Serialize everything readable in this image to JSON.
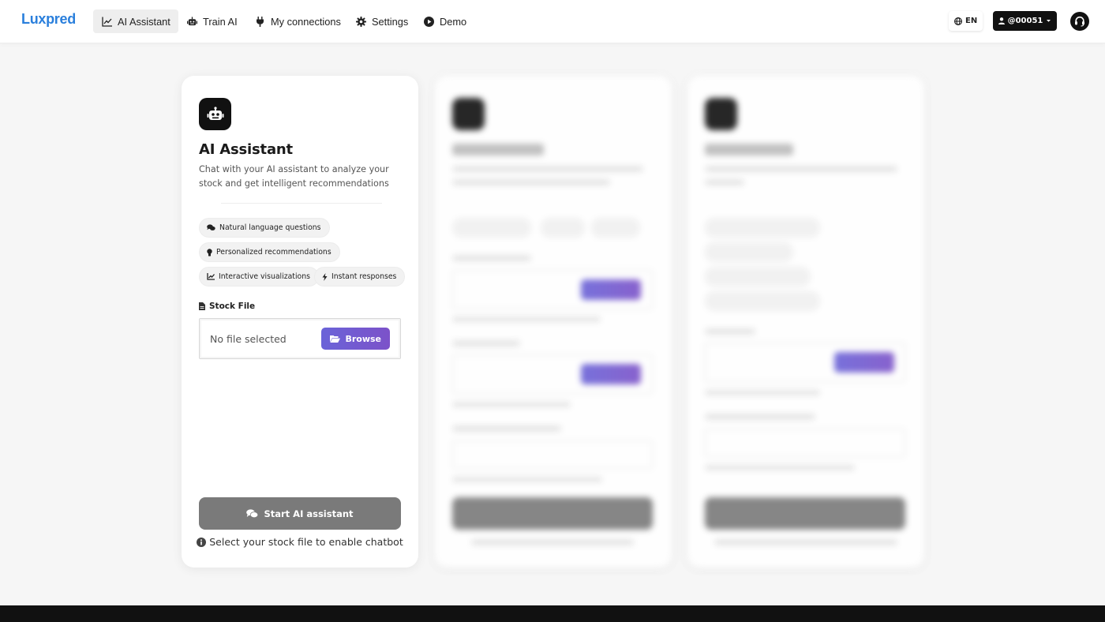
{
  "brand": {
    "logo": "Luxpred"
  },
  "nav": {
    "items": [
      {
        "label": "AI Assistant",
        "icon": "chart-line-icon",
        "active": true
      },
      {
        "label": "Train AI",
        "icon": "robot-icon",
        "active": false
      },
      {
        "label": "My connections",
        "icon": "plug-icon",
        "active": false
      },
      {
        "label": "Settings",
        "icon": "gear-icon",
        "active": false
      },
      {
        "label": "Demo",
        "icon": "play-circle-icon",
        "active": false
      }
    ],
    "language": "EN",
    "user": "@00051"
  },
  "colors": {
    "brand": "#2a7fdc",
    "accent_start": "#6a63d8",
    "accent_end": "#7c52c9",
    "disabled_button": "#7a7a7a",
    "dark": "#111111"
  },
  "assistant_card": {
    "title": "AI Assistant",
    "description": "Chat with your AI assistant to analyze your stock and get intelligent recommendations",
    "features": [
      {
        "label": "Natural language questions",
        "icon": "comments-icon"
      },
      {
        "label": "Personalized recommendations",
        "icon": "lightbulb-icon"
      },
      {
        "label": "Interactive visualizations",
        "icon": "chart-line-icon"
      },
      {
        "label": "Instant responses",
        "icon": "bolt-icon"
      }
    ],
    "file_label": "Stock File",
    "file_placeholder": "No file selected",
    "browse_label": "Browse",
    "start_label": "Start AI assistant",
    "hint": "Select your stock file to enable chatbot"
  }
}
